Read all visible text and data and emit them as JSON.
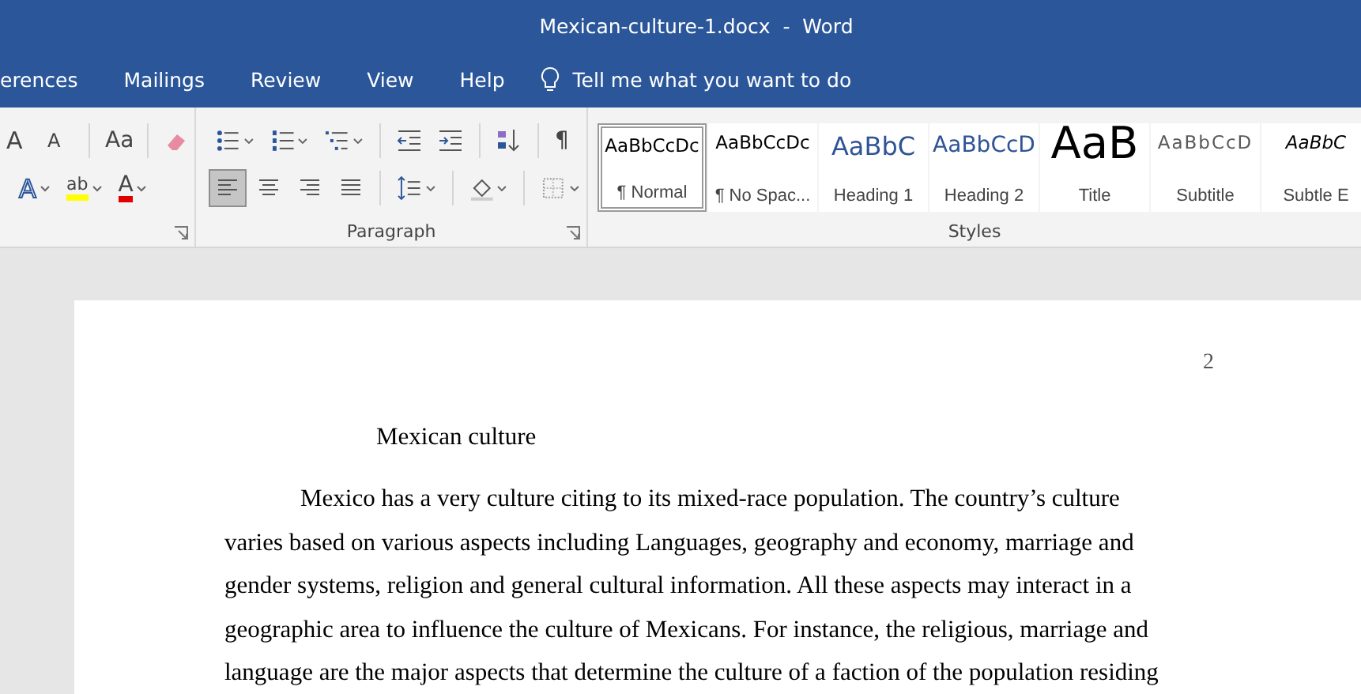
{
  "window": {
    "title": "Mexican-culture-1.docx  -  Word"
  },
  "tabs": [
    {
      "label": "erences",
      "selected": false
    },
    {
      "label": "Mailings",
      "selected": false
    },
    {
      "label": "Review",
      "selected": false
    },
    {
      "label": "View",
      "selected": false
    },
    {
      "label": "Help",
      "selected": false
    }
  ],
  "tell_me": {
    "placeholder": "Tell me what you want to do"
  },
  "font_group": {
    "row1": [
      {
        "kind": "grow",
        "glyph": "A"
      },
      {
        "kind": "shrink",
        "glyph": "A"
      },
      {
        "kind": "case",
        "glyph": "Aa"
      },
      {
        "kind": "clear"
      }
    ],
    "row2": [
      {
        "kind": "effects",
        "glyph": "A"
      },
      {
        "kind": "highlight",
        "glyph": "ab"
      },
      {
        "kind": "font_color",
        "glyph": "A"
      }
    ]
  },
  "paragraph_group": {
    "label": "Paragraph",
    "row1": [
      {
        "kind": "bullets"
      },
      {
        "kind": "numbering"
      },
      {
        "kind": "multilevel"
      },
      {
        "kind": "sep"
      },
      {
        "kind": "outdent"
      },
      {
        "kind": "indent"
      },
      {
        "kind": "sep"
      },
      {
        "kind": "sort"
      },
      {
        "kind": "sep"
      },
      {
        "kind": "marks",
        "glyph": "¶"
      }
    ],
    "alignment": [
      {
        "kind": "left",
        "selected": true
      },
      {
        "kind": "center",
        "selected": false
      },
      {
        "kind": "right",
        "selected": false
      },
      {
        "kind": "justify",
        "selected": false
      }
    ],
    "row2": [
      {
        "kind": "spacing"
      },
      {
        "kind": "shading"
      },
      {
        "kind": "borders"
      }
    ]
  },
  "styles_group": {
    "label": "Styles",
    "items": [
      {
        "preview": "AaBbCcDc",
        "name": "¶ Normal",
        "kind": "normal",
        "selected": true
      },
      {
        "preview": "AaBbCcDc",
        "name": "¶ No Spac...",
        "kind": "normal",
        "selected": false
      },
      {
        "preview": "AaBbC",
        "name": "Heading 1",
        "kind": "heading1",
        "selected": false
      },
      {
        "preview": "AaBbCcD",
        "name": "Heading 2",
        "kind": "heading2",
        "selected": false
      },
      {
        "preview": "AaB",
        "name": "Title",
        "kind": "title",
        "selected": false
      },
      {
        "preview": "AaBbCcD",
        "name": "Subtitle",
        "kind": "subtitle",
        "selected": false
      },
      {
        "preview": "AaBbC",
        "name": "Subtle E",
        "kind": "emphasis",
        "selected": false
      }
    ]
  },
  "document": {
    "page_number": "2",
    "title": "Mexican culture",
    "paragraph_lines": [
      "Mexico has a very culture citing to its mixed-race population. The country’s culture",
      "varies based on various aspects including Languages, geography and economy, marriage and",
      "gender systems, religion and general cultural information. All these aspects may interact in a",
      "geographic area to influence the culture of Mexicans. For instance, the religious, marriage and",
      "language are the major aspects that determine the culture of a faction of the population residing"
    ]
  }
}
